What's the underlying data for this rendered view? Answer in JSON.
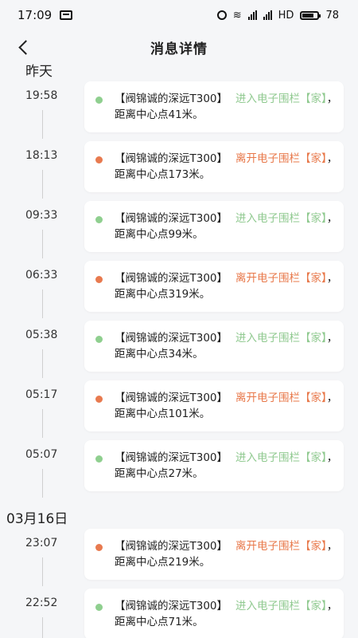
{
  "status_bar": {
    "time": "17:09",
    "battery": "78",
    "hd_label": "HD"
  },
  "header": {
    "title": "消息详情"
  },
  "groups": [
    {
      "date": "昨天",
      "entries": [
        {
          "time": "19:58",
          "type": "enter",
          "prefix": "【阀锦诚的深远T300】",
          "action": "进入电子围栏",
          "zone": "【家】",
          "suffix": "，距离中心点41米。"
        },
        {
          "time": "18:13",
          "type": "leave",
          "prefix": "【阀锦诚的深远T300】",
          "action": "离开电子围栏",
          "zone": "【家】",
          "suffix": "，距离中心点173米。"
        },
        {
          "time": "09:33",
          "type": "enter",
          "prefix": "【阀锦诚的深远T300】",
          "action": "进入电子围栏",
          "zone": "【家】",
          "suffix": "，距离中心点99米。"
        },
        {
          "time": "06:33",
          "type": "leave",
          "prefix": "【阀锦诚的深远T300】",
          "action": "离开电子围栏",
          "zone": "【家】",
          "suffix": "，距离中心点319米。"
        },
        {
          "time": "05:38",
          "type": "enter",
          "prefix": "【阀锦诚的深远T300】",
          "action": "进入电子围栏",
          "zone": "【家】",
          "suffix": "，距离中心点34米。"
        },
        {
          "time": "05:17",
          "type": "leave",
          "prefix": "【阀锦诚的深远T300】",
          "action": "离开电子围栏",
          "zone": "【家】",
          "suffix": "，距离中心点101米。"
        },
        {
          "time": "05:07",
          "type": "enter",
          "prefix": "【阀锦诚的深远T300】",
          "action": "进入电子围栏",
          "zone": "【家】",
          "suffix": "，距离中心点27米。"
        }
      ]
    },
    {
      "date": "03月16日",
      "entries": [
        {
          "time": "23:07",
          "type": "leave",
          "prefix": "【阀锦诚的深远T300】",
          "action": "离开电子围栏",
          "zone": "【家】",
          "suffix": "，距离中心点219米。"
        },
        {
          "time": "22:52",
          "type": "enter",
          "prefix": "【阀锦诚的深远T300】",
          "action": "进入电子围栏",
          "zone": "【家】",
          "suffix": "，距离中心点71米。"
        }
      ]
    }
  ],
  "colors": {
    "enter": "#8fcf8f",
    "leave": "#e87a4f",
    "background": "#f5f6f8",
    "card": "#ffffff"
  }
}
